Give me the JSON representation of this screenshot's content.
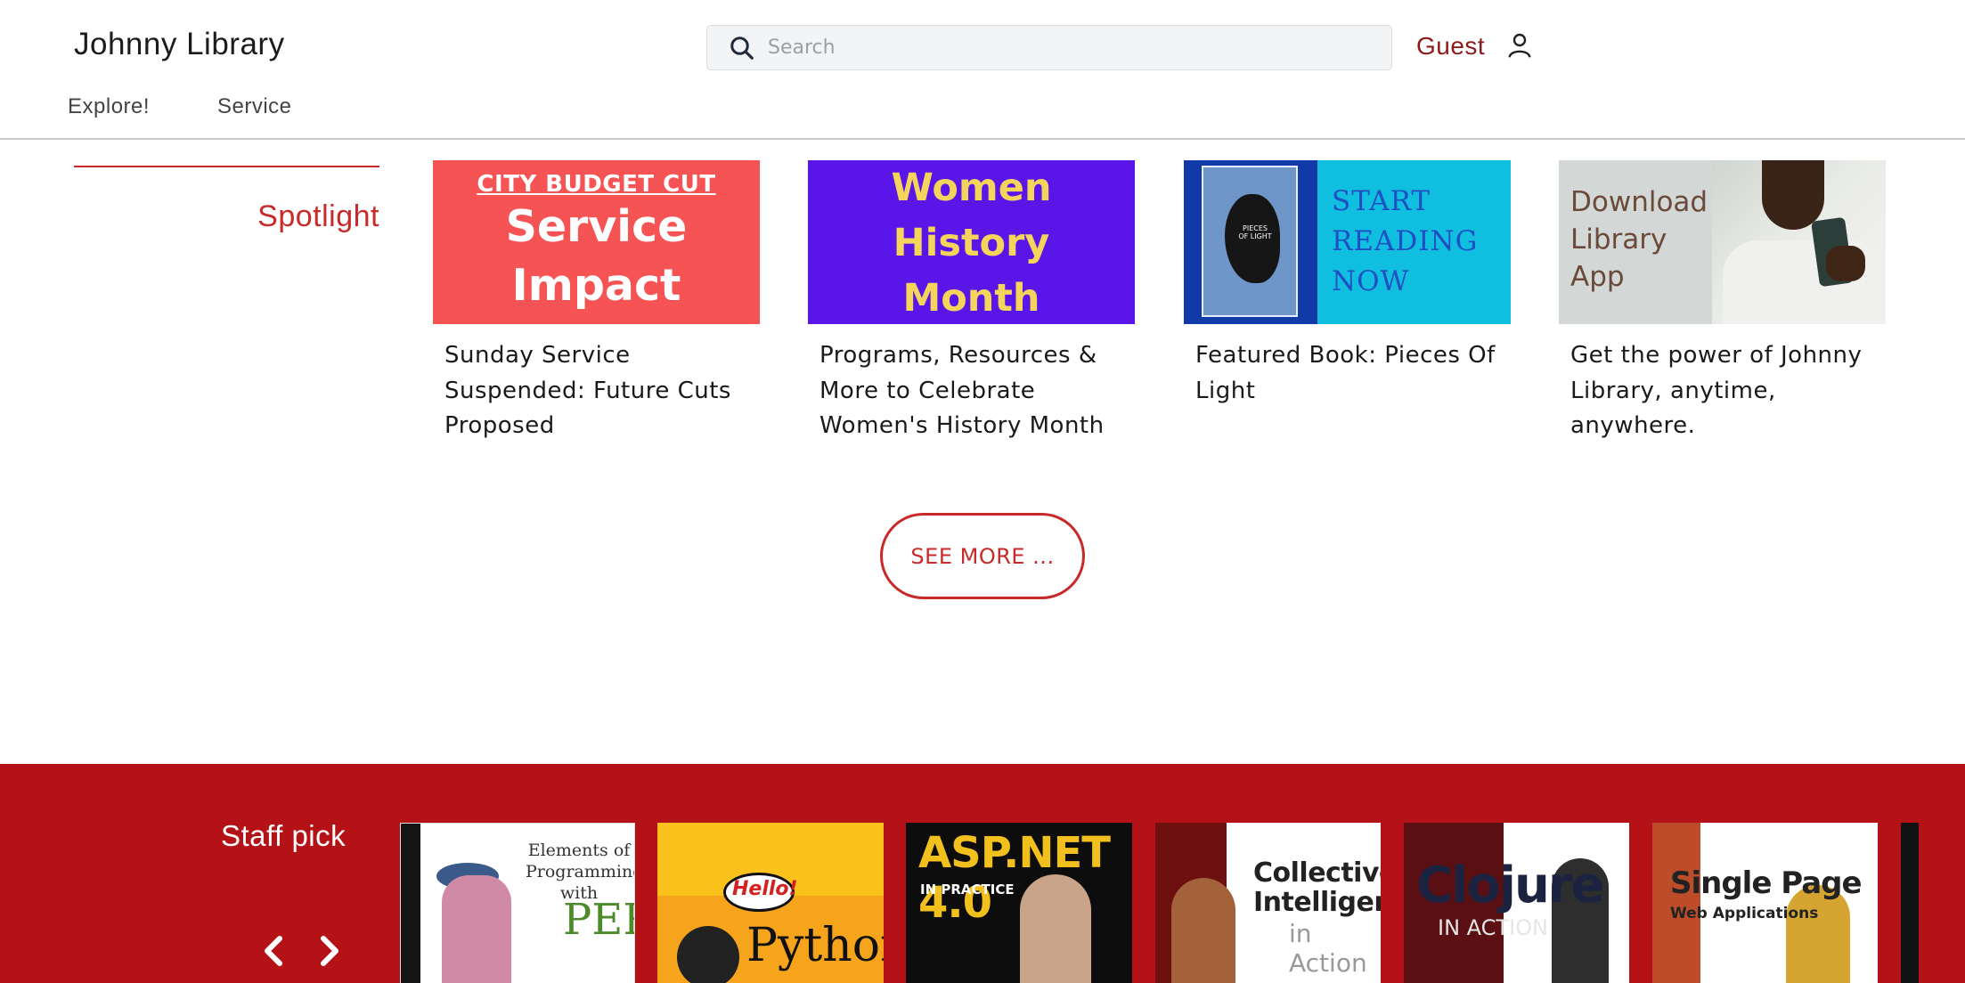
{
  "header": {
    "brand": "Johnny Library",
    "search_placeholder": "Search",
    "user_label": "Guest",
    "nav": [
      "Explore!",
      "Service"
    ]
  },
  "spotlight": {
    "title": "Spotlight",
    "cards": [
      {
        "image_text": [
          "CITY BUDGET CUT",
          "Service",
          "Impact"
        ],
        "caption": "Sunday Service Suspended: Future Cuts Proposed"
      },
      {
        "image_text": [
          "Women",
          "History",
          "Month"
        ],
        "caption": "Programs, Resources & More to Celebrate Women's History Month"
      },
      {
        "image_text": [
          "START",
          "READING",
          "NOW"
        ],
        "cover_text": "PIECES OF LIGHT",
        "caption": "Featured Book: Pieces Of Light"
      },
      {
        "image_text": [
          "Download",
          "Library",
          "App"
        ],
        "caption": "Get the power of Johnny Library, anytime, anywhere."
      }
    ],
    "see_more": "SEE MORE ..."
  },
  "staff_pick": {
    "title": "Staff pick",
    "books": [
      {
        "cover_title": "Elements of Programming with",
        "cover_subtitle": "PERL"
      },
      {
        "cover_title": "Hello!",
        "cover_subtitle": "Python"
      },
      {
        "cover_title": "ASP.NET 4.0",
        "cover_subtitle": "IN PRACTICE"
      },
      {
        "cover_title": "Collective Intelligence",
        "cover_subtitle": "in Action"
      },
      {
        "cover_title": "Clojure",
        "cover_subtitle": "IN ACTION"
      },
      {
        "cover_title": "Single Page",
        "cover_subtitle": "Web Applications"
      }
    ]
  },
  "colors": {
    "accent": "#c82a2a",
    "staff_bg": "#b51218",
    "user_label": "#8b1a1a"
  },
  "icons": [
    "search-icon",
    "user-icon",
    "chevron-left-icon",
    "chevron-right-icon"
  ]
}
